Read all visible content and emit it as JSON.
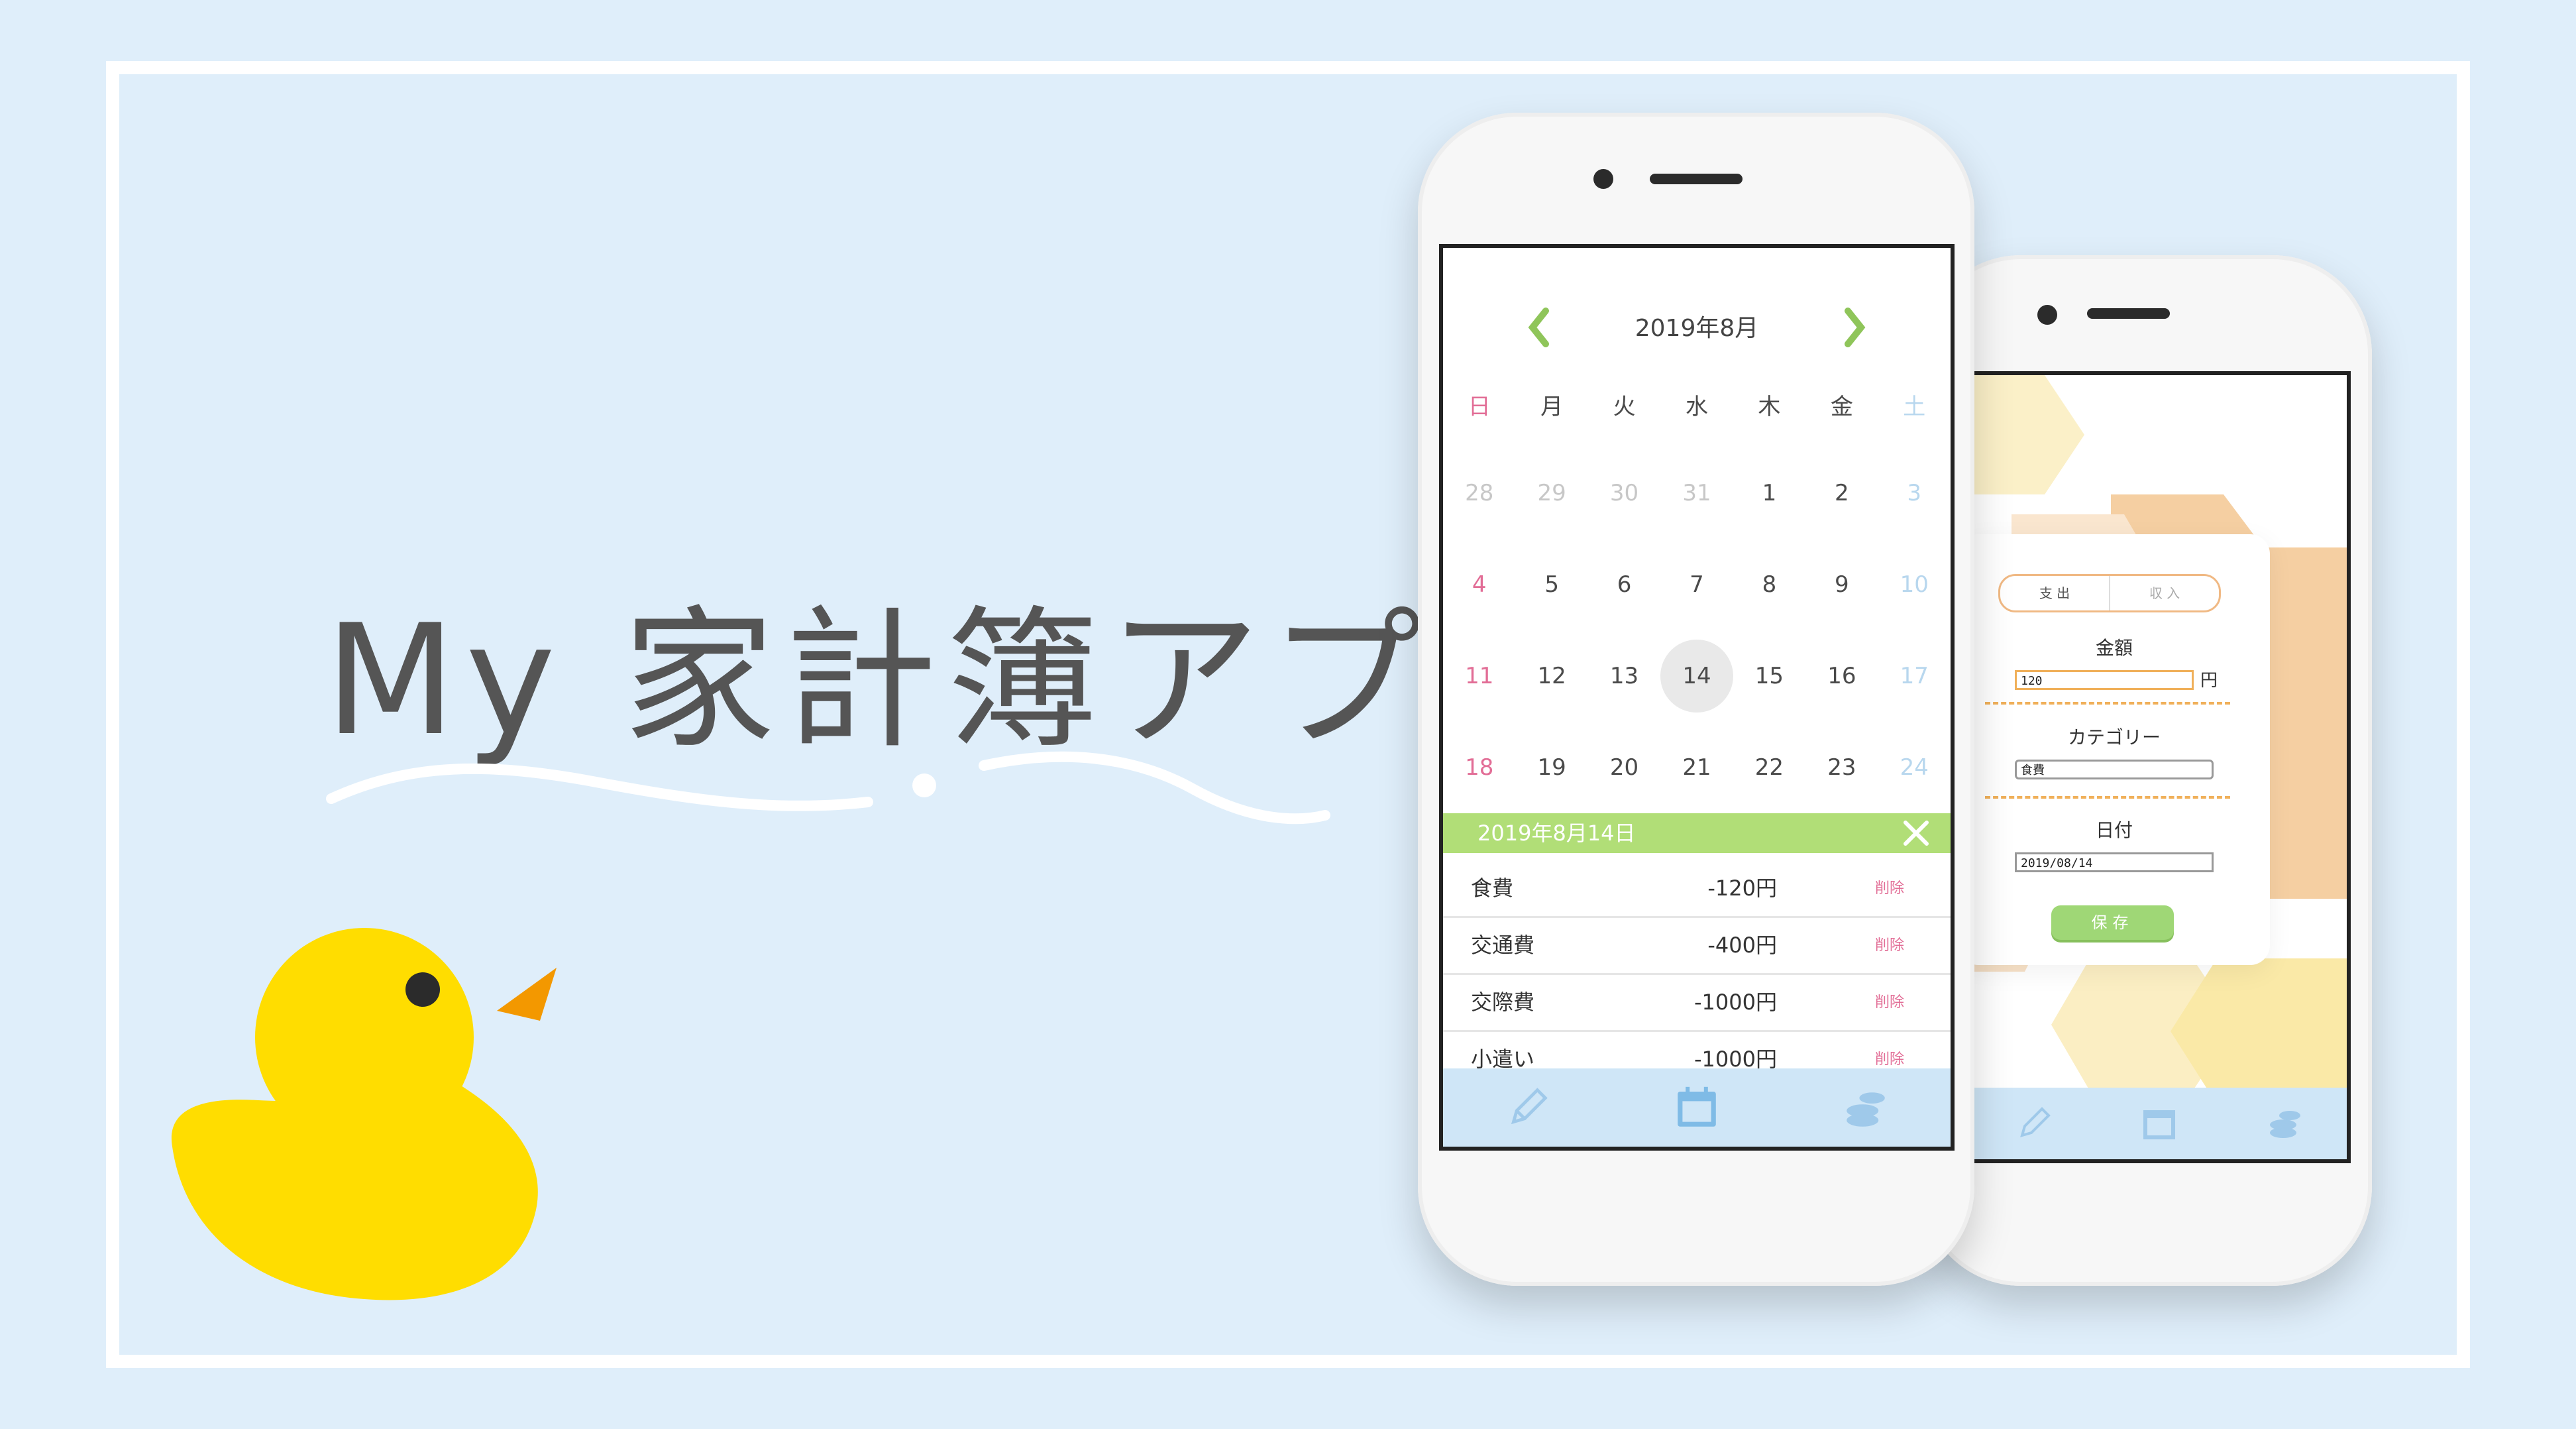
{
  "app_title": "My 家計簿アプリ",
  "calendar": {
    "month_title": "2019年8月",
    "weekdays": [
      "日",
      "月",
      "火",
      "水",
      "木",
      "金",
      "土"
    ],
    "weeks": [
      [
        "28",
        "29",
        "30",
        "31",
        "1",
        "2",
        "3"
      ],
      [
        "4",
        "5",
        "6",
        "7",
        "8",
        "9",
        "10"
      ],
      [
        "11",
        "12",
        "13",
        "14",
        "15",
        "16",
        "17"
      ],
      [
        "18",
        "19",
        "20",
        "21",
        "22",
        "23",
        "24"
      ]
    ],
    "selected_day": "14"
  },
  "day_detail": {
    "date_label": "2019年8月14日",
    "delete_label": "削除",
    "entries": [
      {
        "category": "食費",
        "amount": "-120円"
      },
      {
        "category": "交通費",
        "amount": "-400円"
      },
      {
        "category": "交際費",
        "amount": "-1000円"
      },
      {
        "category": "小遣い",
        "amount": "-1000円"
      }
    ]
  },
  "tabs": [
    {
      "icon": "pencil-icon"
    },
    {
      "icon": "calendar-icon"
    },
    {
      "icon": "coins-icon"
    }
  ],
  "form": {
    "segment_expense": "支 出",
    "segment_income": "収 入",
    "amount_label": "金額",
    "amount_value": "120",
    "currency": "円",
    "category_label": "カテゴリー",
    "category_value": "食費",
    "date_label": "日付",
    "date_value": "2019/08/14",
    "save_label": "保存"
  },
  "colors": {
    "background": "#dfeefa",
    "accent_green": "#b1de77",
    "sunday_pink": "#e26d96",
    "saturday_blue": "#b8d7ee",
    "duck_yellow": "#ffdd00",
    "beak_orange": "#f39800"
  }
}
